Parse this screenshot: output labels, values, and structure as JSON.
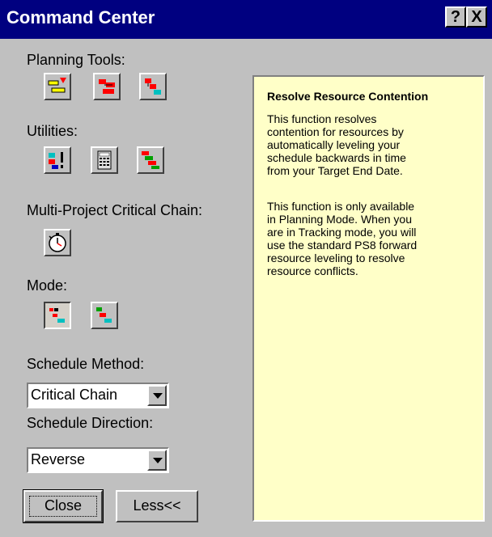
{
  "window": {
    "title": "Command Center"
  },
  "titlebar_buttons": {
    "help": "?",
    "close": "X"
  },
  "sections": {
    "planning_tools": "Planning Tools:",
    "utilities": "Utilities:",
    "multi_project": "Multi-Project Critical Chain:",
    "mode": "Mode:",
    "schedule_method": "Schedule Method:",
    "schedule_direction": "Schedule Direction:"
  },
  "icons": {
    "planning_tools": [
      "gantt-add-task-icon",
      "gantt-edit-icon",
      "gantt-link-icon"
    ],
    "utilities": [
      "resolve-contention-icon",
      "calculator-icon",
      "resource-leveling-icon"
    ],
    "multi_project": [
      "stopwatch-icon"
    ],
    "mode": [
      "planning-mode-icon",
      "tracking-mode-icon"
    ]
  },
  "selects": {
    "schedule_method": "Critical Chain",
    "schedule_direction": "Reverse"
  },
  "buttons": {
    "close": "Close",
    "less": "Less<<"
  },
  "info_panel": {
    "title": "Resolve Resource Contention",
    "paragraph1": "This function resolves\ncontention for resources by\nautomatically leveling your\nschedule backwards in time\nfrom your Target End Date.",
    "paragraph2": "This function is only available\nin Planning Mode.  When you\nare in Tracking mode, you will\nuse the standard PS8 forward\nresource leveling to resolve\nresource conflicts."
  },
  "colors": {
    "title_bar": "#000080",
    "face": "#c0c0c0",
    "info_background": "#ffffc8",
    "gantt_red": "#ff0000",
    "gantt_yellow": "#ffff00",
    "gantt_cyan": "#00c0c0",
    "gantt_green": "#00a000",
    "gantt_blue": "#0000c0"
  }
}
